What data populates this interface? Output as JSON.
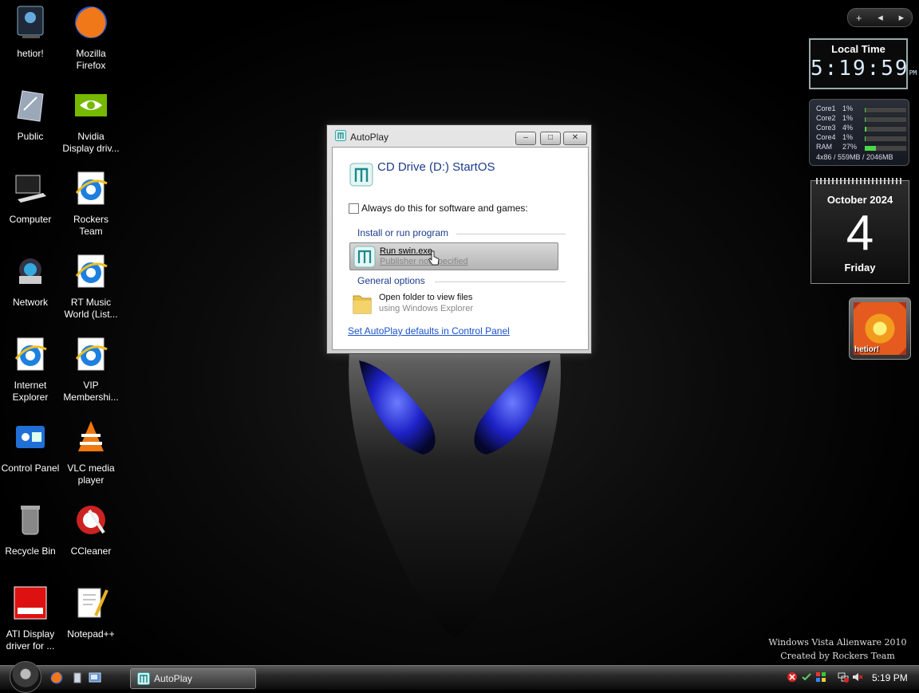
{
  "desktop": {
    "icons": [
      {
        "label": "hetior!",
        "icon": "user-folder-icon"
      },
      {
        "label": "Mozilla Firefox",
        "icon": "firefox-icon"
      },
      {
        "label": "Public",
        "icon": "public-folder-icon"
      },
      {
        "label": "Nvidia Display driv...",
        "icon": "nvidia-icon"
      },
      {
        "label": "Computer",
        "icon": "computer-icon"
      },
      {
        "label": "Rockers Team",
        "icon": "internet-explorer-icon"
      },
      {
        "label": "Network",
        "icon": "network-icon"
      },
      {
        "label": "RT Music World (List...",
        "icon": "internet-explorer-icon"
      },
      {
        "label": "Internet Explorer",
        "icon": "internet-explorer-icon"
      },
      {
        "label": "VIP Membershi...",
        "icon": "internet-explorer-icon"
      },
      {
        "label": "Control Panel",
        "icon": "control-panel-icon"
      },
      {
        "label": "VLC media player",
        "icon": "vlc-icon"
      },
      {
        "label": "Recycle Bin",
        "icon": "recycle-bin-icon"
      },
      {
        "label": "CCleaner",
        "icon": "ccleaner-icon"
      },
      {
        "label": "ATI Display driver for ...",
        "icon": "ati-icon"
      },
      {
        "label": "Notepad++",
        "icon": "notepad-plus-icon"
      }
    ]
  },
  "sidebar": {
    "controls": {
      "add": "+",
      "prev": "◂",
      "next": "▸"
    },
    "clock": {
      "title": "Local Time",
      "time": "5:19:59",
      "ampm": "PM"
    },
    "cpu": {
      "rows": [
        {
          "name": "Core1",
          "percent": "1%",
          "level": 0.01
        },
        {
          "name": "Core2",
          "percent": "1%",
          "level": 0.01
        },
        {
          "name": "Core3",
          "percent": "4%",
          "level": 0.04
        },
        {
          "name": "Core4",
          "percent": "1%",
          "level": 0.01
        },
        {
          "name": "RAM",
          "percent": "27%",
          "level": 0.27
        }
      ],
      "footer": "4x86 / 559MB / 2046MB"
    },
    "calendar": {
      "month": "October 2024",
      "day": "4",
      "weekday": "Friday"
    },
    "photo": {
      "caption": "hetior!"
    }
  },
  "dialog": {
    "title": "AutoPlay",
    "drive_title": "CD Drive (D:) StartOS",
    "always_label": "Always do this for software and games:",
    "section_install": "Install or run program",
    "run_label": "Run swin.exe",
    "run_sub": "Publisher not specified",
    "section_general": "General options",
    "folder_label": "Open folder to view files",
    "folder_sub": "using Windows Explorer",
    "defaults_link": "Set AutoPlay defaults in Control Panel",
    "buttons": {
      "min": "–",
      "max": "□",
      "close": "✕"
    }
  },
  "watermark": {
    "line1": "Windows Vista Alienware 2010",
    "line2": "Created by Rockers Team"
  },
  "taskbar": {
    "task_label": "AutoPlay",
    "time": "5:19 PM"
  },
  "colors": {
    "accent": "#1a3c8c",
    "link": "#1a52c8",
    "ram_bar": "#4ad94a"
  }
}
